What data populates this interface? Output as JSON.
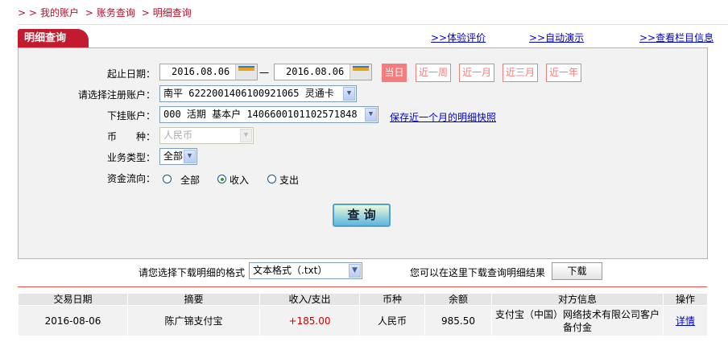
{
  "breadcrumb": {
    "items": [
      "我的账户",
      "账务查询",
      "明细查询"
    ]
  },
  "tab": {
    "title": "明细查询"
  },
  "top_links": [
    ">>体验评价",
    ">>自动演示",
    ">>查看栏目信息"
  ],
  "form": {
    "date_label": "起止日期：",
    "start_date": "2016.08.06",
    "dash": "一",
    "end_date": "2016.08.06",
    "quick_ranges": [
      "当日",
      "近一周",
      "近一月",
      "近三月",
      "近一年"
    ],
    "quick_active": "当日",
    "account_label": "请选择注册账户：",
    "account_value": "南平 6222001406100921065 灵通卡",
    "sub_account_label": "下挂账户：",
    "sub_account_value": "000 活期 基本户 1406600101102571848",
    "snapshot_link": "保存近一个月的明细快照",
    "currency_label": "币　　种：",
    "currency_value": "人民币",
    "type_label": "业务类型：",
    "type_value": "全部",
    "flow_label": "资金流向：",
    "flow_options": [
      "全部",
      "收入",
      "支出"
    ],
    "flow_selected": "收入",
    "query_button": "查 询"
  },
  "download": {
    "label": "请您选择下载明细的格式",
    "format_value": "文本格式（.txt）",
    "hint": "您可以在这里下载查询明细结果",
    "button": "下载"
  },
  "table": {
    "headers": [
      "交易日期",
      "摘要",
      "收入/支出",
      "币种",
      "余额",
      "对方信息",
      "操作"
    ],
    "rows": [
      {
        "date": "2016-08-06",
        "summary": "陈广锦支付宝",
        "amount": "+185.00",
        "currency": "人民币",
        "balance": "985.50",
        "counterparty": "支付宝（中国）网络技术有限公司客户备付金",
        "action": "详情"
      }
    ]
  },
  "colors": {
    "brand_red": "#c21a2e",
    "quick_button": "#f57c7c",
    "amount_income": "#cc0000",
    "link": "#0000cc"
  }
}
